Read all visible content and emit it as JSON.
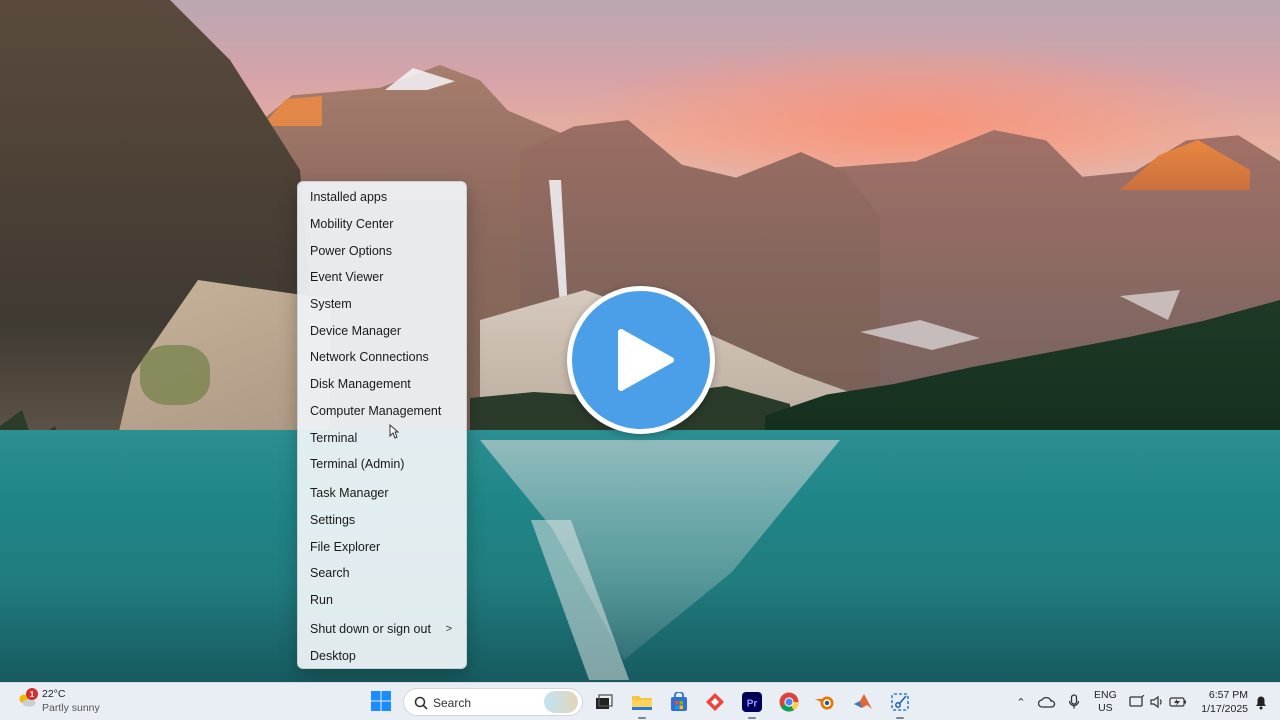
{
  "context_menu": {
    "items": [
      {
        "label": "Installed apps"
      },
      {
        "label": "Mobility Center"
      },
      {
        "label": "Power Options"
      },
      {
        "label": "Event Viewer"
      },
      {
        "label": "System"
      },
      {
        "label": "Device Manager"
      },
      {
        "label": "Network Connections"
      },
      {
        "label": "Disk Management"
      },
      {
        "label": "Computer Management"
      },
      {
        "label": "Terminal"
      },
      {
        "label": "Terminal (Admin)"
      },
      {
        "label": "Task Manager"
      },
      {
        "label": "Settings"
      },
      {
        "label": "File Explorer"
      },
      {
        "label": "Search"
      },
      {
        "label": "Run"
      },
      {
        "label": "Shut down or sign out",
        "submenu_chevron": ">"
      },
      {
        "label": "Desktop"
      }
    ]
  },
  "taskbar": {
    "weather": {
      "badge": "1",
      "temperature": "22°C",
      "condition": "Partly sunny"
    },
    "search": {
      "placeholder": "Search"
    },
    "pinned_apps": [
      "windows-start",
      "file-explorer",
      "file-manager",
      "microsoft-store",
      "anydesk",
      "premiere-pro",
      "chrome",
      "blender",
      "matlab",
      "snipping-tool"
    ],
    "premiere_label": "Pr",
    "tray": {
      "language_line1": "ENG",
      "language_line2": "US",
      "time": "6:57 PM",
      "date": "1/17/2025"
    }
  },
  "colors": {
    "taskbar_bg": "#e9eef4",
    "menu_bg": "#eef3f6",
    "play_button": "#4b9fe8",
    "accent_blue": "#0078d4"
  }
}
